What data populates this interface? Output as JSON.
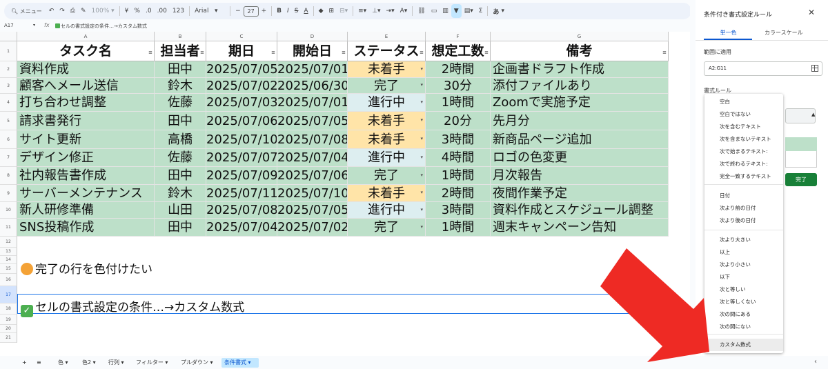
{
  "toolbar": {
    "menu_label": "メニュー",
    "zoom": "100%",
    "currency": "¥",
    "percent": "%",
    "dec_dec": ".0",
    "dec_inc": ".00",
    "number_format": "123",
    "font": "Arial",
    "font_size": "27",
    "bold": "B",
    "italic": "I",
    "strike": "S",
    "text_color": "A",
    "sum": "Σ",
    "input_tools": "あ"
  },
  "namebox": "A17",
  "formula": "セルの書式設定の条件…→カスタム数式",
  "columns": [
    "A",
    "B",
    "C",
    "D",
    "E",
    "F",
    "G"
  ],
  "rows": [
    "1",
    "2",
    "3",
    "4",
    "5",
    "6",
    "7",
    "8",
    "9",
    "10",
    "11",
    "12",
    "13",
    "14",
    "15",
    "16",
    "17",
    "18",
    "19",
    "20",
    "21"
  ],
  "table": {
    "headers": [
      "タスク名",
      "担当者",
      "期日",
      "開始日",
      "ステータス",
      "想定工数",
      "備考"
    ],
    "rows": [
      [
        "資料作成",
        "田中",
        "2025/07/05",
        "2025/07/01",
        "未着手",
        "2時間",
        "企画書ドラフト作成"
      ],
      [
        "顧客へメール送信",
        "鈴木",
        "2025/07/02",
        "2025/06/30",
        "完了",
        "30分",
        "添付ファイルあり"
      ],
      [
        "打ち合わせ調整",
        "佐藤",
        "2025/07/03",
        "2025/07/01",
        "進行中",
        "1時間",
        "Zoomで実施予定"
      ],
      [
        "請求書発行",
        "田中",
        "2025/07/06",
        "2025/07/05",
        "未着手",
        "20分",
        "先月分"
      ],
      [
        "サイト更新",
        "高橋",
        "2025/07/10",
        "2025/07/08",
        "未着手",
        "3時間",
        "新商品ページ追加"
      ],
      [
        "デザイン修正",
        "佐藤",
        "2025/07/07",
        "2025/07/04",
        "進行中",
        "4時間",
        "ロゴの色変更"
      ],
      [
        "社内報告書作成",
        "田中",
        "2025/07/09",
        "2025/07/06",
        "完了",
        "1時間",
        "月次報告"
      ],
      [
        "サーバーメンテナンス",
        "鈴木",
        "2025/07/11",
        "2025/07/10",
        "未着手",
        "2時間",
        "夜間作業予定"
      ],
      [
        "新人研修準備",
        "山田",
        "2025/07/08",
        "2025/07/05",
        "進行中",
        "3時間",
        "資料作成とスケジュール調整"
      ],
      [
        "SNS投稿作成",
        "田中",
        "2025/07/04",
        "2025/07/02",
        "完了",
        "1時間",
        "週末キャンペーン告知"
      ]
    ]
  },
  "notes": {
    "row14": "完了の行を色付けたい",
    "row17": "セルの書式設定の条件…→カスタム数式"
  },
  "sheet_tabs": [
    "色",
    "色2",
    "行列",
    "フィルター",
    "プルダウン",
    "条件書式"
  ],
  "active_tab": "条件書式",
  "panel": {
    "title": "条件付き書式設定ルール",
    "tab_single": "単一色",
    "tab_scale": "カラースケール",
    "range_label": "範囲に適用",
    "range_value": "A2:G11",
    "rule_label": "書式ルール",
    "done": "完了"
  },
  "dropdown_items": [
    "空白",
    "空白ではない",
    "次を含むテキスト",
    "次を含まないテキスト",
    "次で始まるテキスト:",
    "次で終わるテキスト:",
    "完全一致するテキスト",
    "日付",
    "次より前の日付",
    "次より後の日付",
    "次より大きい",
    "以上",
    "次より小さい",
    "以下",
    "次と等しい",
    "次と等しくない",
    "次の間にある",
    "次の間にない",
    "カスタム数式"
  ],
  "colors": {
    "row_green": "#bde0c9",
    "todo_orange": "#ffe4a8",
    "inprogress_blue": "#ddeef0",
    "accent_blue": "#0b57d0",
    "done_button": "#188038",
    "arrow_red": "#ee2a24"
  }
}
